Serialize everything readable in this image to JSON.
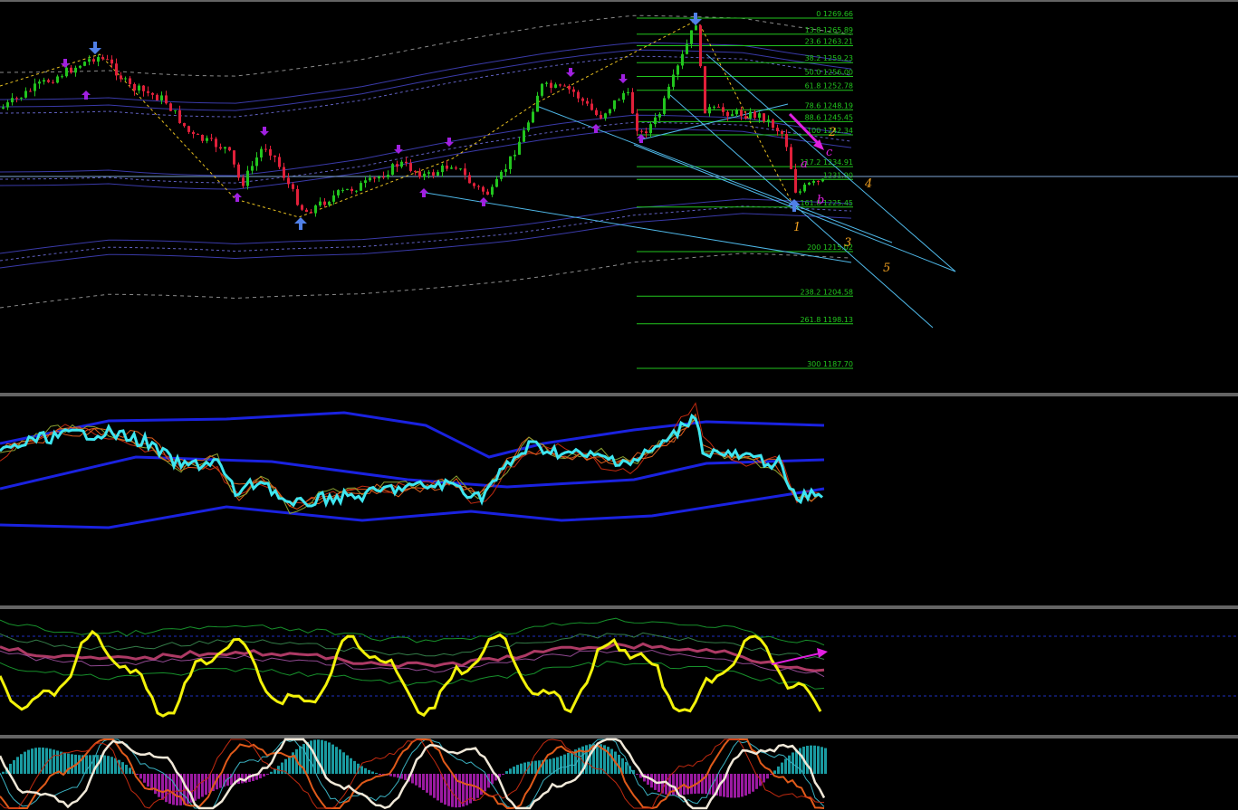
{
  "chart_data": {
    "type": "line",
    "description_panels": [
      "price",
      "bands_oscillator",
      "rsi_bands",
      "stochastic_macd"
    ],
    "fib_levels": [
      {
        "label": "0 1269.66"
      },
      {
        "label": "13.8 1265.89"
      },
      {
        "label": "23.6 1263.21"
      },
      {
        "label": "38.2 1259.23"
      },
      {
        "label": "50.0 1256.00"
      },
      {
        "label": "61.8 1252.78"
      },
      {
        "label": "78.6 1248.19"
      },
      {
        "label": "88.6 1245.45"
      },
      {
        "label": "100 1242.34"
      },
      {
        "label": "117.2 1234.91"
      },
      {
        "label": "1231.90"
      },
      {
        "label": "161.8 1225.45"
      },
      {
        "label": "200 1215.02"
      },
      {
        "label": "238.2 1204.58"
      },
      {
        "label": "261.8 1198.13"
      },
      {
        "label": "300 1187.70"
      }
    ],
    "wave_labels": {
      "orange": [
        "1",
        "2",
        "3",
        "4",
        "5"
      ],
      "magenta": [
        "a",
        "b",
        "c"
      ]
    },
    "colors": {
      "background": "#000000",
      "bull_candle": "#22c51e",
      "bear_candle": "#e0203a",
      "fib": "#22c51e",
      "trendline": "#4fb8e8",
      "oscillator_main": "#3ee6f0",
      "rsi_main": "#f2f20a",
      "band_blue": "#1a22e0",
      "arrow_magenta": "#e020e0",
      "wave_orange": "#f0a020"
    }
  }
}
